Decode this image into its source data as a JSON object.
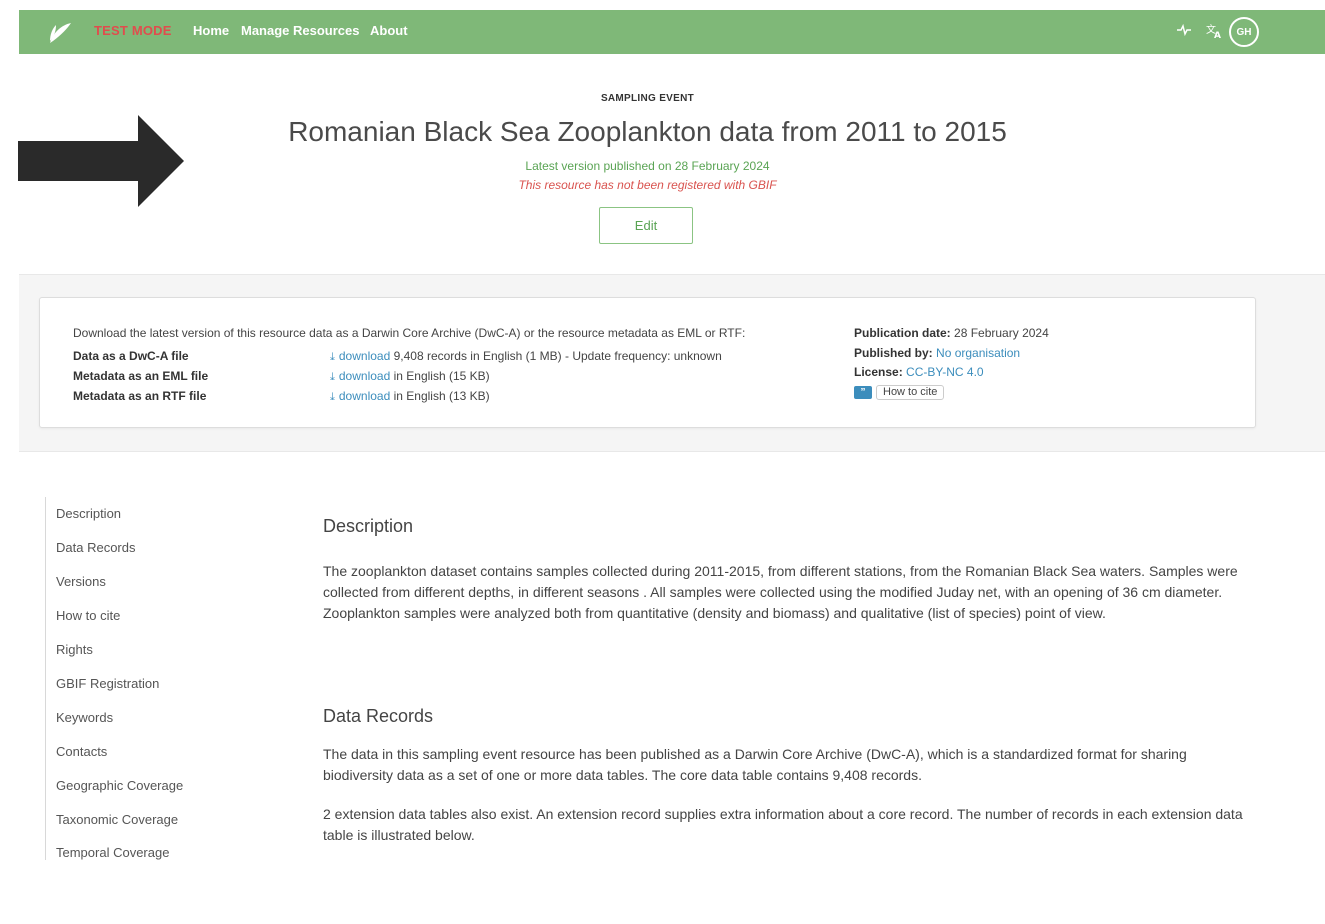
{
  "navbar": {
    "test_mode": "TEST MODE",
    "links": [
      "Home",
      "Manage Resources",
      "About"
    ],
    "avatar_initials": "GH",
    "icons": [
      "leaf-logo-icon",
      "pulse-icon",
      "translate-icon"
    ],
    "background": "#7fb878"
  },
  "header": {
    "resource_type": "SAMPLING EVENT",
    "title": "Romanian Black Sea Zooplankton data from 2011 to 2015",
    "latest_version": "Latest version published on 28 February 2024",
    "not_registered": "This resource has not been registered with GBIF",
    "edit_label": "Edit"
  },
  "downloads": {
    "intro": "Download the latest version of this resource data as a Darwin Core Archive (DwC-A) or the resource metadata as EML or RTF:",
    "rows": [
      {
        "label": "Data as a DwC-A file",
        "link": "download",
        "detail": "9,408 records in English (1 MB) - Update frequency: unknown"
      },
      {
        "label": "Metadata as an EML file",
        "link": "download",
        "detail": "in English (15 KB)"
      },
      {
        "label": "Metadata as an RTF file",
        "link": "download",
        "detail": "in English (13 KB)"
      }
    ]
  },
  "meta": {
    "publication_date_label": "Publication date:",
    "publication_date": "28 February 2024",
    "published_by_label": "Published by:",
    "published_by": "No organisation",
    "license_label": "License:",
    "license": "CC-BY-NC 4.0",
    "cite_label": "How to cite"
  },
  "sidebar": {
    "items": [
      "Description",
      "Data Records",
      "Versions",
      "How to cite",
      "Rights",
      "GBIF Registration",
      "Keywords",
      "Contacts",
      "Geographic Coverage",
      "Taxonomic Coverage",
      "Temporal Coverage"
    ]
  },
  "content": {
    "description_heading": "Description",
    "description_text": "The zooplankton dataset contains samples collected during 2011-2015, from different stations, from the Romanian Black Sea waters. Samples were collected from different depths, in different seasons . All samples were collected using the modified Juday net, with an opening of 36 cm diameter. Zooplankton samples were analyzed both from quantitative (density and biomass) and qualitative (list of species) point of view.",
    "data_records_heading": "Data Records",
    "data_records_text1": "The data in this sampling event resource has been published as a Darwin Core Archive (DwC-A), which is a standardized format for sharing biodiversity data as a set of one or more data tables. The core data table contains 9,408 records.",
    "data_records_text2": "2 extension data tables also exist. An extension record supplies extra information about a core record. The number of records in each extension data table is illustrated below."
  }
}
